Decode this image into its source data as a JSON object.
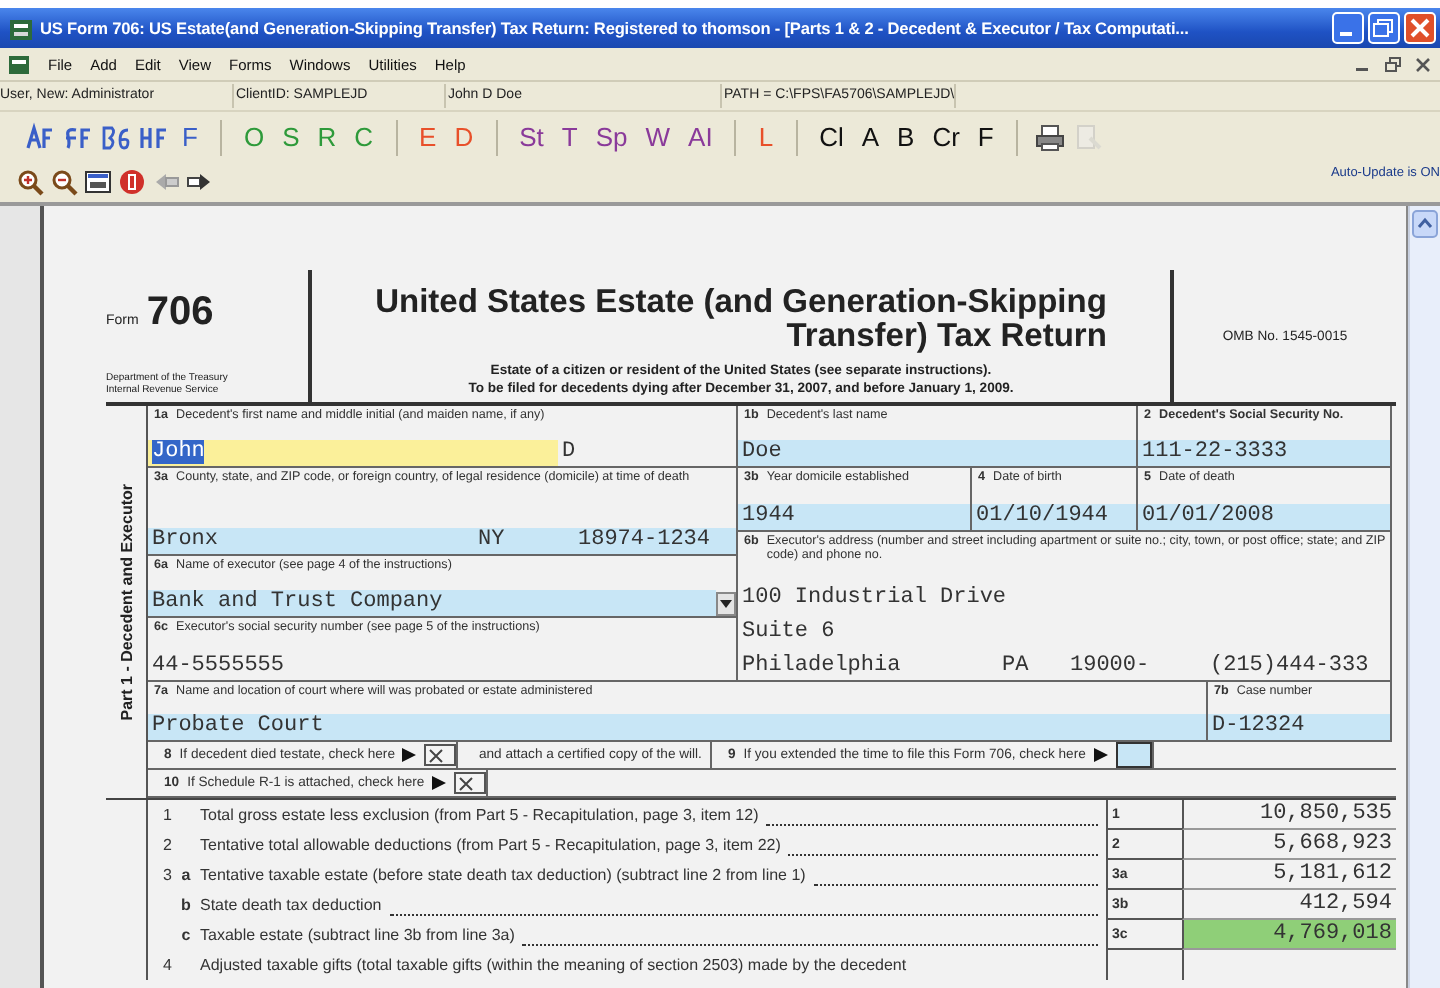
{
  "window": {
    "title": "US Form 706: US Estate(and Generation-Skipping Transfer) Tax Return: Registered to thomson - [Parts 1 & 2 - Decedent & Executor / Tax Computati..."
  },
  "menu": [
    "File",
    "Add",
    "Edit",
    "View",
    "Forms",
    "Windows",
    "Utilities",
    "Help"
  ],
  "info_bar": [
    "User, New: Administrator",
    "ClientID: SAMPLEJD",
    "John D Doe",
    "PATH = C:\\FPS\\FA5706\\SAMPLEJD\\"
  ],
  "toolbar": {
    "groups": [
      [
        {
          "kind": "icon",
          "disabled": false
        },
        {
          "kind": "icon",
          "disabled": false
        },
        {
          "kind": "icon",
          "disabled": false
        },
        {
          "kind": "icon",
          "disabled": false
        },
        {
          "kind": "text",
          "label": "F",
          "color": "#3a5fc8"
        }
      ],
      [
        {
          "kind": "text",
          "label": "O",
          "color": "#2e9a3a"
        },
        {
          "kind": "text",
          "label": "S",
          "color": "#2e9a3a"
        },
        {
          "kind": "text",
          "label": "R",
          "color": "#2e9a3a"
        },
        {
          "kind": "text",
          "label": "C",
          "color": "#2e9a3a"
        }
      ],
      [
        {
          "kind": "text",
          "label": "E",
          "color": "#e8502a"
        },
        {
          "kind": "text",
          "label": "D",
          "color": "#e8502a"
        }
      ],
      [
        {
          "kind": "text",
          "label": "St",
          "color": "#8a3a9a"
        },
        {
          "kind": "text",
          "label": "T",
          "color": "#8a3a9a"
        },
        {
          "kind": "text",
          "label": "Sp",
          "color": "#8a3a9a"
        },
        {
          "kind": "text",
          "label": "W",
          "color": "#8a3a9a"
        },
        {
          "kind": "text",
          "label": "AI",
          "color": "#8a3a9a"
        }
      ],
      [
        {
          "kind": "text",
          "label": "L",
          "color": "#e8502a"
        }
      ],
      [
        {
          "kind": "text",
          "label": "Cl",
          "color": "#111111"
        },
        {
          "kind": "text",
          "label": "A",
          "color": "#111111"
        },
        {
          "kind": "text",
          "label": "B",
          "color": "#111111"
        },
        {
          "kind": "text",
          "label": "Cr",
          "color": "#111111"
        },
        {
          "kind": "text",
          "label": "F",
          "color": "#111111"
        }
      ],
      [
        {
          "kind": "icon",
          "disabled": false
        },
        {
          "kind": "icon",
          "disabled": true
        }
      ]
    ]
  },
  "auto_update": "Auto-Update is ON",
  "form": {
    "form_word": "Form",
    "form_number": "706",
    "department": [
      "Department of the Treasury",
      "Internal Revenue Service"
    ],
    "title": [
      "United States Estate (and Generation-Skipping",
      "Transfer) Tax Return"
    ],
    "subtitle": [
      "Estate of a citizen or resident of the United States (see separate instructions).",
      "To be filed for decedents dying after December 31, 2007, and before January 1, 2009."
    ],
    "omb": "OMB No. 1545-0015",
    "part_label": "Part 1 - Decedent and Executor",
    "fields": [
      {
        "number": "1a",
        "label": "Decedent's first name and middle initial (and maiden name, if any)",
        "bold": false,
        "lines": [
          [
            {
              "text": "John",
              "shaded": true,
              "focused": true
            },
            {
              "text": "D",
              "shaded": false,
              "focused": false
            }
          ]
        ]
      },
      {
        "number": "1b",
        "label": "Decedent's last name",
        "bold": false,
        "lines": [
          [
            {
              "text": "Doe",
              "shaded": true,
              "focused": false
            }
          ]
        ]
      },
      {
        "number": "2",
        "label": "Decedent's Social Security No.",
        "bold": true,
        "lines": [
          [
            {
              "text": "111-22-3333",
              "shaded": true,
              "focused": false
            }
          ]
        ]
      },
      {
        "number": "3a",
        "label": "County, state, and ZIP code, or foreign country, of legal residence (domicile) at time of death",
        "bold": false,
        "lines": [
          [
            {
              "text": "Bronx",
              "shaded": true,
              "focused": false
            },
            {
              "text": "NY",
              "shaded": true,
              "focused": false
            },
            {
              "text": "18974-1234",
              "shaded": true,
              "focused": false
            }
          ]
        ]
      },
      {
        "number": "3b",
        "label": "Year domicile established",
        "bold": false,
        "lines": [
          [
            {
              "text": "1944",
              "shaded": true,
              "focused": false
            }
          ]
        ]
      },
      {
        "number": "4",
        "label": "Date of birth",
        "bold": false,
        "lines": [
          [
            {
              "text": "01/10/1944",
              "shaded": true,
              "focused": false
            }
          ]
        ]
      },
      {
        "number": "5",
        "label": "Date of death",
        "bold": false,
        "lines": [
          [
            {
              "text": "01/01/2008",
              "shaded": true,
              "focused": false
            }
          ]
        ]
      },
      {
        "number": "6a",
        "label": "Name of executor (see page 4 of the instructions)",
        "bold": false,
        "dropdown": true,
        "lines": [
          [
            {
              "text": "Bank and Trust Company",
              "shaded": true,
              "focused": false
            }
          ]
        ]
      },
      {
        "number": "6c",
        "label": "Executor's social security number (see page 5 of the instructions)",
        "bold": false,
        "lines": [
          [
            {
              "text": "44-5555555",
              "shaded": false,
              "focused": false
            }
          ]
        ]
      },
      {
        "number": "6b",
        "label": "Executor's address (number and street including apartment or suite no.; city, town, or post office; state; and ZIP code) and phone no.",
        "bold": false,
        "lines": [
          [
            {
              "text": "100 Industrial Drive",
              "shaded": false,
              "focused": false
            }
          ],
          [
            {
              "text": "Suite 6",
              "shaded": false,
              "focused": false
            }
          ],
          [
            {
              "text": "Philadelphia",
              "shaded": false,
              "focused": false
            },
            {
              "text": "PA",
              "shaded": false,
              "focused": false
            },
            {
              "text": "19000-",
              "shaded": false,
              "focused": false
            },
            {
              "text": "(215)444-333",
              "shaded": false,
              "focused": false
            }
          ]
        ]
      },
      {
        "number": "7a",
        "label": "Name and location of court where will was probated or estate administered",
        "bold": false,
        "lines": [
          [
            {
              "text": "Probate Court",
              "shaded": true,
              "focused": false
            }
          ]
        ]
      },
      {
        "number": "7b",
        "label": "Case number",
        "bold": false,
        "lines": [
          [
            {
              "text": "D-12324",
              "shaded": true,
              "focused": false
            }
          ]
        ]
      }
    ],
    "check_rows": [
      [
        {
          "kind": "check",
          "number": "8",
          "text": "If decedent died testate, check here",
          "checked": true
        },
        {
          "kind": "note",
          "text": "and attach a certified copy of the will."
        },
        {
          "kind": "check",
          "number": "9",
          "text": "If you extended the time to file this Form 706, check here",
          "checked": false
        }
      ],
      [
        {
          "kind": "check",
          "number": "10",
          "text": "If Schedule R-1 is attached, check here",
          "checked": true
        }
      ]
    ],
    "lines": [
      {
        "number": "1",
        "text": "Total gross estate less exclusion (from Part 5 - Recapitulation, page 3, item 12)",
        "ref": "1",
        "amount": "10,850,535",
        "highlight": false
      },
      {
        "number": "2",
        "text": "Tentative total allowable deductions (from Part 5 - Recapitulation, page 3, item 22)",
        "ref": "2",
        "amount": "5,668,923",
        "highlight": false
      },
      {
        "number": "3",
        "sub": "a",
        "text": "Tentative taxable estate (before state death tax deduction) (subtract line 2 from line 1)",
        "ref": "3a",
        "amount": "5,181,612",
        "highlight": false
      },
      {
        "sub": "b",
        "text": "State death tax deduction",
        "ref": "3b",
        "amount": "412,594",
        "highlight": false
      },
      {
        "sub": "c",
        "text": "Taxable estate (subtract line 3b from line 3a)",
        "ref": "3c",
        "amount": "4,769,018",
        "highlight": true
      },
      {
        "number": "4",
        "text": "Adjusted taxable gifts (total taxable gifts (within the meaning of section 2503) made by the decedent"
      }
    ]
  }
}
